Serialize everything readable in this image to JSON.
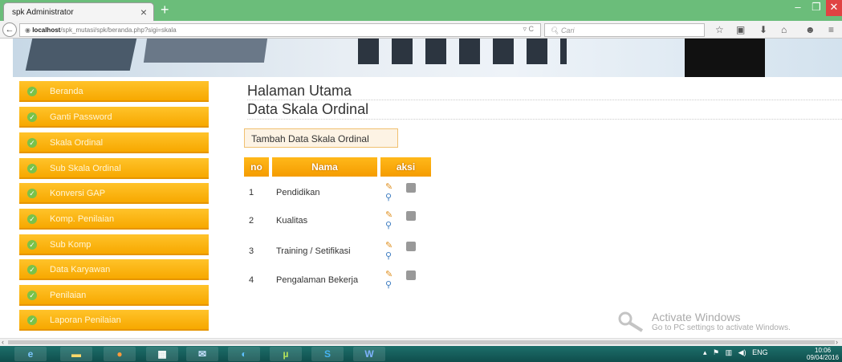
{
  "browser": {
    "tab_title": "spk Administrator",
    "tab_close": "×",
    "new_tab": "+",
    "url_host": "localhost",
    "url_path": "/spk_mutasi/spk/beranda.php?sigi=skala",
    "search_placeholder": "Cari",
    "icons": [
      "star-icon",
      "reader-icon",
      "download-icon",
      "home-icon",
      "chat-icon",
      "menu-icon"
    ]
  },
  "sidebar": {
    "items": [
      {
        "label": "Beranda"
      },
      {
        "label": "Ganti Password"
      },
      {
        "label": "Skala Ordinal"
      },
      {
        "label": "Sub Skala Ordinal"
      },
      {
        "label": "Konversi GAP"
      },
      {
        "label": "Komp. Penilaian"
      },
      {
        "label": "Sub Komp"
      },
      {
        "label": "Data Karyawan"
      },
      {
        "label": "Penilaian"
      },
      {
        "label": "Laporan Penilaian"
      }
    ]
  },
  "main": {
    "page_title": "Halaman Utama",
    "section_title": "Data Skala Ordinal",
    "add_button": "Tambah Data Skala Ordinal",
    "table": {
      "headers": {
        "no": "no",
        "nama": "Nama",
        "aksi": "aksi"
      },
      "rows": [
        {
          "no": "1",
          "nama": "Pendidikan"
        },
        {
          "no": "2",
          "nama": "Kualitas"
        },
        {
          "no": "3",
          "nama": "Training / Setifikasi"
        },
        {
          "no": "4",
          "nama": "Pengalaman Bekerja"
        }
      ]
    }
  },
  "watermark": {
    "title": "Activate Windows",
    "subtitle": "Go to PC settings to activate Windows."
  },
  "taskbar": {
    "lang": "ENG",
    "time": "10:06",
    "date": "09/04/2016"
  },
  "colors": {
    "tabbar": "#6bbd7a",
    "menu_orange": "#f7a800",
    "header_orange": "#f59c00",
    "taskbar": "#1d6f6b"
  }
}
